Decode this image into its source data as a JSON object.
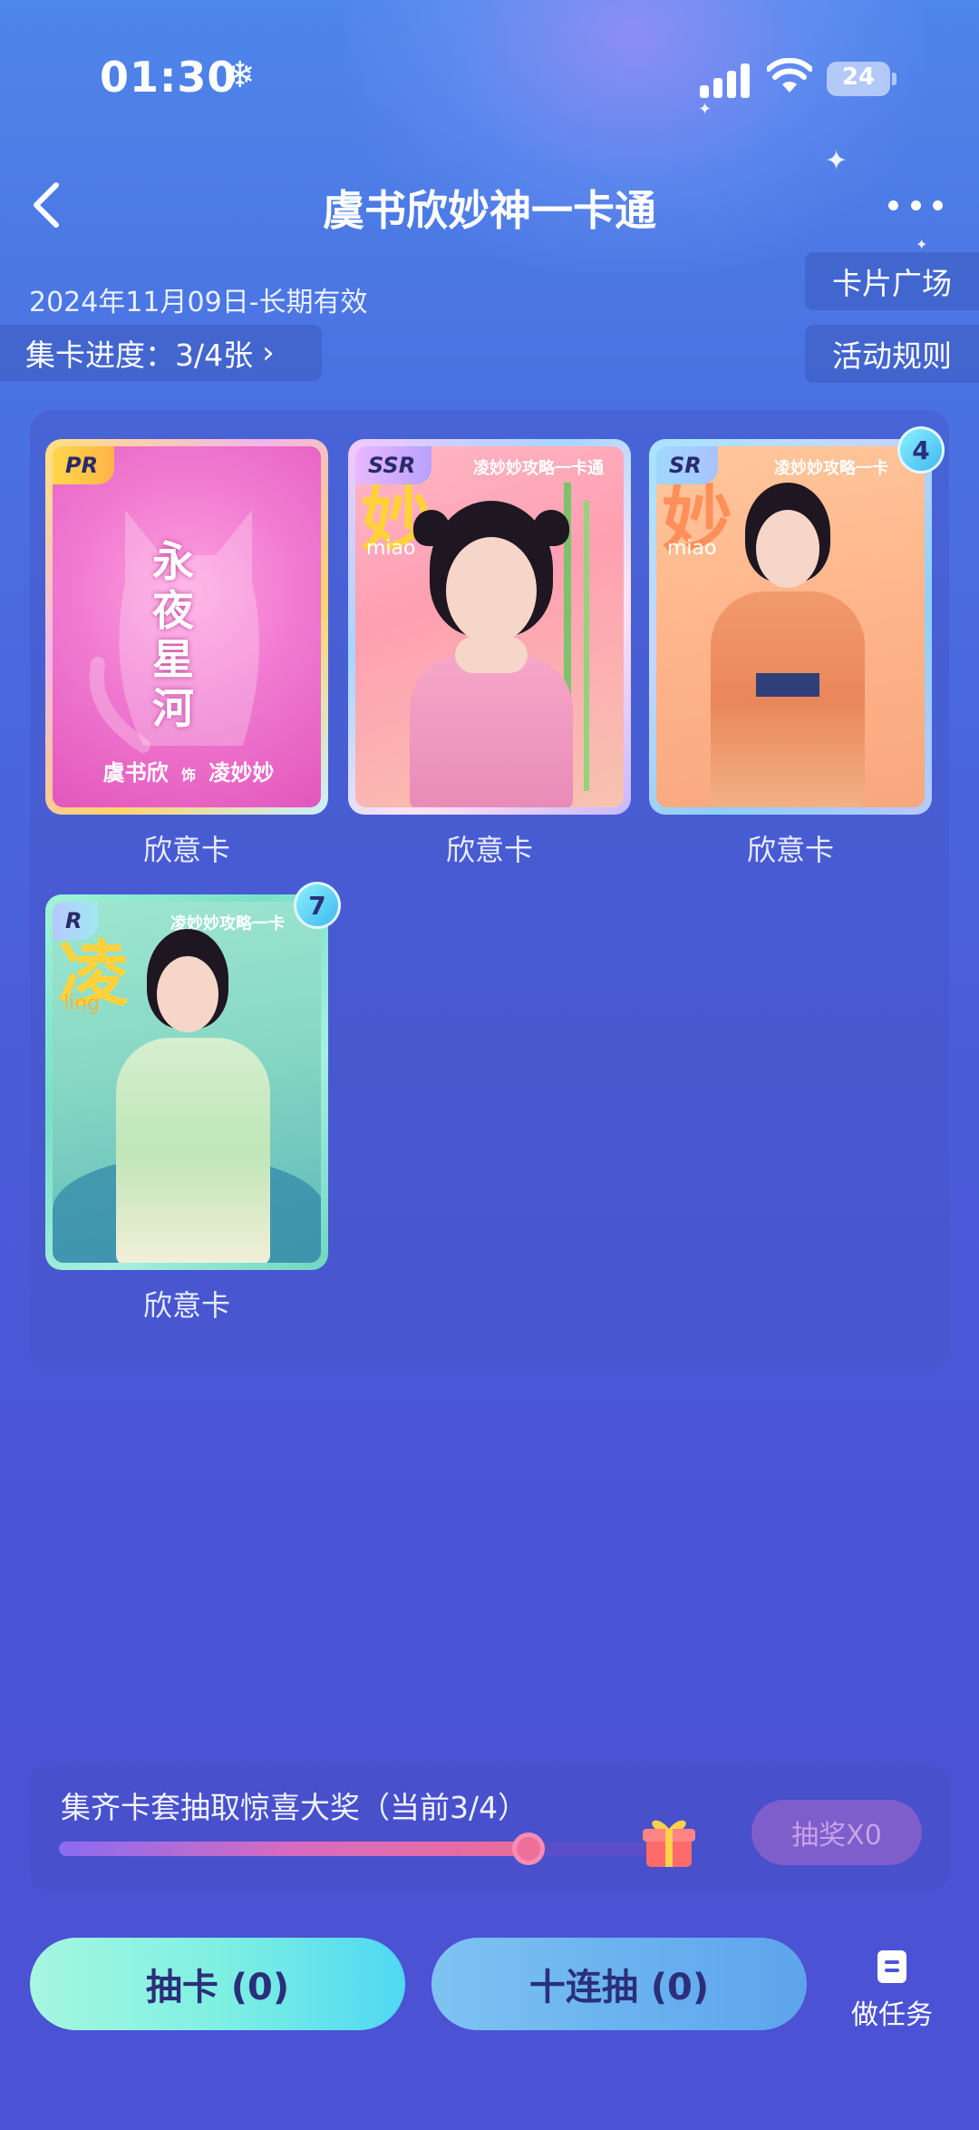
{
  "status_bar": {
    "time": "01:30",
    "battery": "24"
  },
  "header": {
    "title": "虞书欣妙神一卡通"
  },
  "info": {
    "date_range": "2024年11月09日-长期有效",
    "progress_label": "集卡进度：3/4张",
    "card_square": "卡片广场",
    "rules": "活动规则"
  },
  "cards": [
    {
      "rarity": "PR",
      "label": "欣意卡",
      "count": null,
      "text": "永夜星河",
      "names": "虞书欣",
      "names2": "凌妙妙"
    },
    {
      "rarity": "SSR",
      "label": "欣意卡",
      "count": null,
      "text": "凌妙妙攻略一卡通",
      "pinyin": "miao",
      "big": "妙"
    },
    {
      "rarity": "SR",
      "label": "欣意卡",
      "count": "4",
      "text": "凌妙妙攻略一卡",
      "pinyin": "miao",
      "big": "妙"
    },
    {
      "rarity": "R",
      "label": "欣意卡",
      "count": "7",
      "text": "凌妙妙攻略一卡",
      "pinyin": "ling",
      "big": "凌"
    }
  ],
  "prize": {
    "title": "集齐卡套抽取惊喜大奖（当前3/4）",
    "progress": 0.75,
    "button": "抽奖X0"
  },
  "actions": {
    "draw_one": "抽卡 (0)",
    "draw_ten": "十连抽 (0)",
    "tasks": "做任务"
  },
  "colors": {
    "accent_green": "#9ef5d8",
    "accent_blue": "#8fd4f8",
    "badge": "#3fb8f0"
  }
}
